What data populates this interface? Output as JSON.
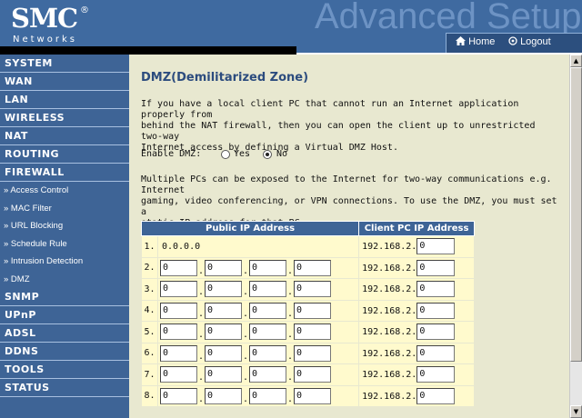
{
  "header": {
    "logo": "SMC",
    "logo_reg": "®",
    "logo_sub": "Networks",
    "banner": "Advanced Setup",
    "home_label": "Home",
    "logout_label": "Logout",
    "home_icon": "house-icon",
    "logout_icon": "power-icon"
  },
  "sidebar": {
    "menu_top": [
      "SYSTEM",
      "WAN",
      "LAN",
      "WIRELESS",
      "NAT",
      "ROUTING",
      "FIREWALL"
    ],
    "firewall_sub": [
      "» Access Control",
      "» MAC Filter",
      "» URL Blocking",
      "» Schedule Rule",
      "» Intrusion Detection",
      "» DMZ"
    ],
    "active_sub": "» DMZ",
    "menu_bottom": [
      "SNMP",
      "UPnP",
      "ADSL",
      "DDNS",
      "TOOLS",
      "STATUS"
    ]
  },
  "content": {
    "title": "DMZ(Demilitarized Zone)",
    "intro_lines": [
      "If you have a local client PC that cannot run an Internet application properly from",
      "behind the NAT firewall, then you can open the client up to unrestricted two-way",
      "Internet access by defining a Virtual DMZ Host."
    ],
    "enable_label": "Enable DMZ:",
    "yes_label": "Yes",
    "no_label": "No",
    "dmz_enabled": "No",
    "desc_lines": [
      "Multiple PCs can be exposed to the Internet for two-way communications e.g. Internet",
      "gaming, video conferencing, or VPN connections.  To use the DMZ, you must set a",
      "static IP address for that PC."
    ],
    "table": {
      "header_public": "Public IP Address",
      "header_client": "Client PC IP Address",
      "client_prefix": "192.168.2.",
      "rows": [
        {
          "index": "1.",
          "public_text": "0.0.0.0",
          "public": [],
          "client": "0"
        },
        {
          "index": "2.",
          "public_text": "",
          "public": [
            "0",
            "0",
            "0",
            "0"
          ],
          "client": "0"
        },
        {
          "index": "3.",
          "public_text": "",
          "public": [
            "0",
            "0",
            "0",
            "0"
          ],
          "client": "0"
        },
        {
          "index": "4.",
          "public_text": "",
          "public": [
            "0",
            "0",
            "0",
            "0"
          ],
          "client": "0"
        },
        {
          "index": "5.",
          "public_text": "",
          "public": [
            "0",
            "0",
            "0",
            "0"
          ],
          "client": "0"
        },
        {
          "index": "6.",
          "public_text": "",
          "public": [
            "0",
            "0",
            "0",
            "0"
          ],
          "client": "0"
        },
        {
          "index": "7.",
          "public_text": "",
          "public": [
            "0",
            "0",
            "0",
            "0"
          ],
          "client": "0"
        },
        {
          "index": "8.",
          "public_text": "",
          "public": [
            "0",
            "0",
            "0",
            "0"
          ],
          "client": "0"
        }
      ]
    }
  },
  "colors": {
    "header_bg": "#3f6aa0",
    "sidebar_bg": "#3e6496",
    "content_bg": "#e8e8d0",
    "title_color": "#2c4c7e",
    "table_header_bg": "#3e6496",
    "table_cell_bg": "#fffacd"
  }
}
